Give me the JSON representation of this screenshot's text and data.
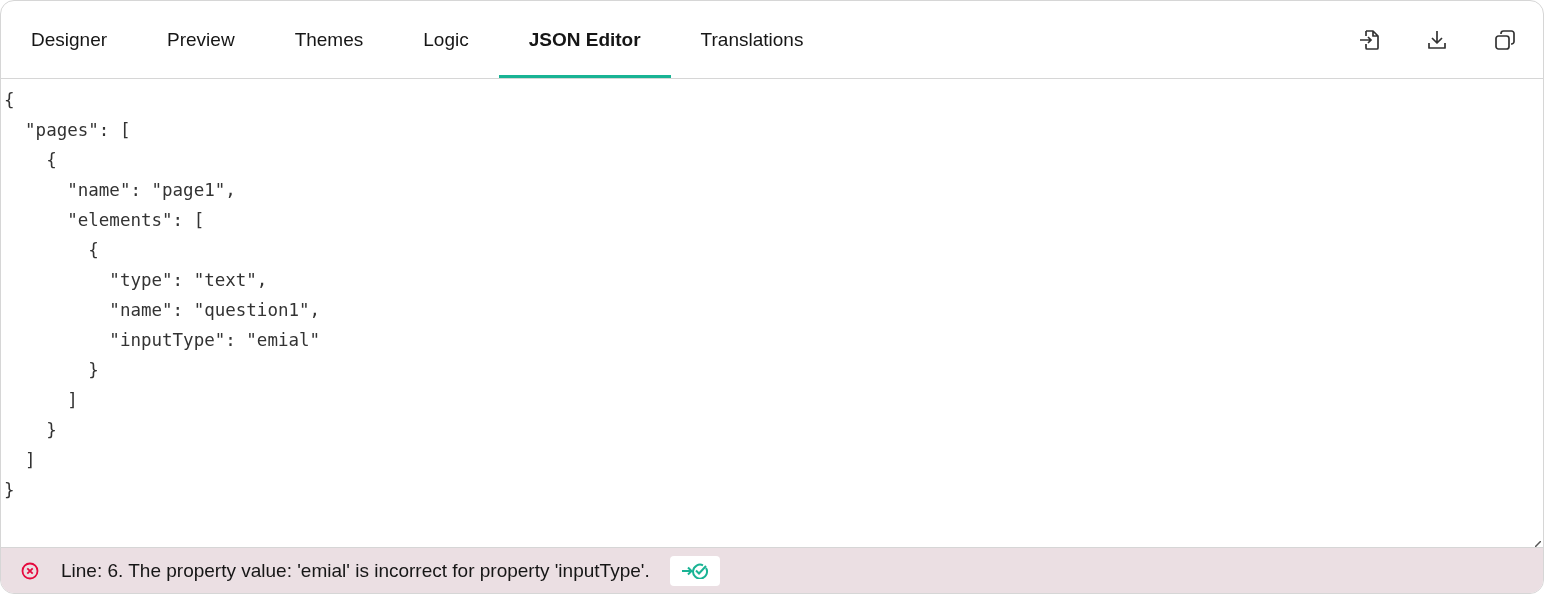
{
  "tabs": [
    {
      "label": "Designer",
      "selected": false
    },
    {
      "label": "Preview",
      "selected": false
    },
    {
      "label": "Themes",
      "selected": false
    },
    {
      "label": "Logic",
      "selected": false
    },
    {
      "label": "JSON Editor",
      "selected": true
    },
    {
      "label": "Translations",
      "selected": false
    }
  ],
  "toolbar": [
    {
      "kind": "import"
    },
    {
      "kind": "download"
    },
    {
      "kind": "copy"
    }
  ],
  "editor": {
    "lines": [
      "{",
      "  \"pages\": [",
      "    {",
      "      \"name\": \"page1\",",
      "      \"elements\": [",
      "        {",
      "          \"type\": \"text\",",
      "          \"name\": \"question1\",",
      "          \"inputType\": \"emial\"",
      "        }",
      "      ]",
      "    }",
      "  ]",
      "}"
    ]
  },
  "error_bar": {
    "message": "Line: 6. The property value: 'emial' is incorrect for property 'inputType'."
  }
}
